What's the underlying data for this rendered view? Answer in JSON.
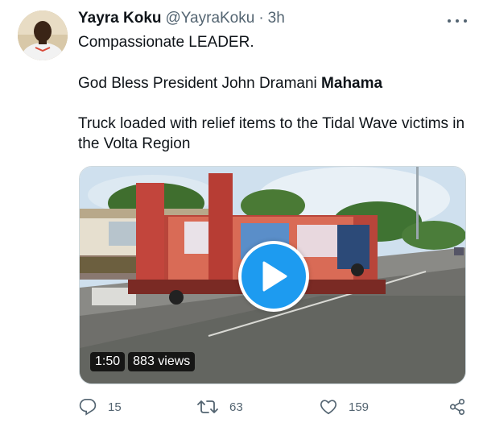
{
  "tweet": {
    "display_name": "Yayra Koku",
    "handle": "@YayraKoku",
    "separator": "·",
    "time": "3h",
    "text": {
      "line1": "Compassionate LEADER.",
      "line2_prefix": "God Bless President John Dramani ",
      "line2_bold": "Mahama",
      "line3": "Truck loaded with relief items to the Tidal Wave victims in",
      "line4": "the Volta Region"
    },
    "video": {
      "duration": "1:50",
      "views": "883 views"
    },
    "actions": {
      "reply_count": "15",
      "retweet_count": "63",
      "like_count": "159"
    }
  },
  "colors": {
    "accent": "#1d9bf0",
    "secondary_text": "#536471",
    "primary_text": "#0f1419"
  },
  "icons": {
    "reply": "reply-icon",
    "retweet": "retweet-icon",
    "like": "heart-icon",
    "share": "share-icon",
    "more": "more-dots-icon",
    "play": "play-icon"
  }
}
